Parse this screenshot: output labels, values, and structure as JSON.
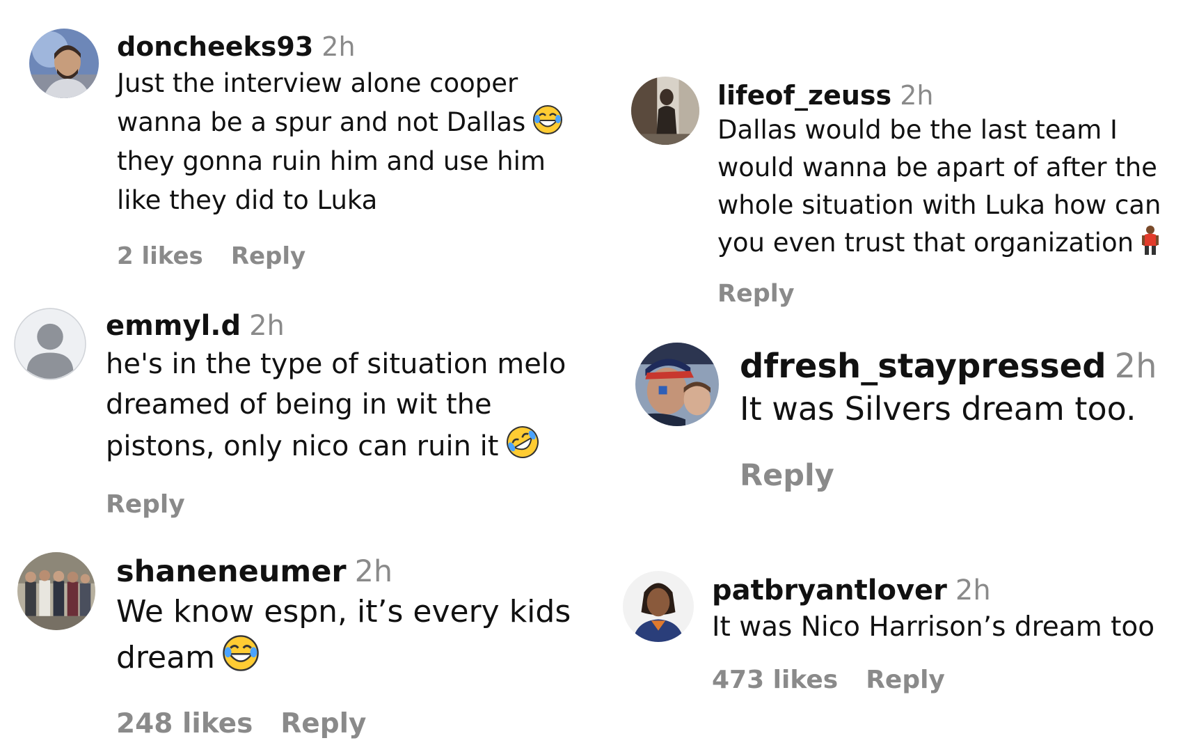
{
  "comments": [
    {
      "username": "doncheeks93",
      "time": "2h",
      "text_lines": [
        "Just the interview alone cooper",
        "wanna be a spur and not Dallas",
        "they gonna ruin him and use him",
        "like they did to Luka"
      ],
      "emoji": "joy-emoji",
      "likes": "2 likes",
      "reply": "Reply"
    },
    {
      "username": "emmyl.d",
      "time": "2h",
      "text_lines": [
        "he's in the type of situation melo",
        "dreamed of being in wit the",
        "pistons, only nico can ruin it"
      ],
      "emoji": "rofl-emoji",
      "reply": "Reply"
    },
    {
      "username": "shaneneumer",
      "time": "2h",
      "text_lines": [
        "We know espn, it’s every kids",
        "dream"
      ],
      "emoji": "joy-emoji",
      "likes": "248 likes",
      "reply": "Reply"
    },
    {
      "username": "lifeof_zeuss",
      "time": "2h",
      "text_lines": [
        "Dallas would be the last team I",
        "would wanna be apart of after the",
        "whole situation with Luka how can",
        "you even trust that organization"
      ],
      "emoji": "person-standing-emoji",
      "reply": "Reply"
    },
    {
      "username": "dfresh_staypressed",
      "time": "2h",
      "text_lines": [
        "It was Silvers dream too."
      ],
      "reply": "Reply"
    },
    {
      "username": "patbryantlover",
      "time": "2h",
      "text_lines": [
        "It was Nico Harrison’s dream too"
      ],
      "likes": "473 likes",
      "reply": "Reply"
    }
  ],
  "colors": {
    "text": "#111111",
    "muted": "#8a8a8a",
    "background": "#ffffff"
  }
}
